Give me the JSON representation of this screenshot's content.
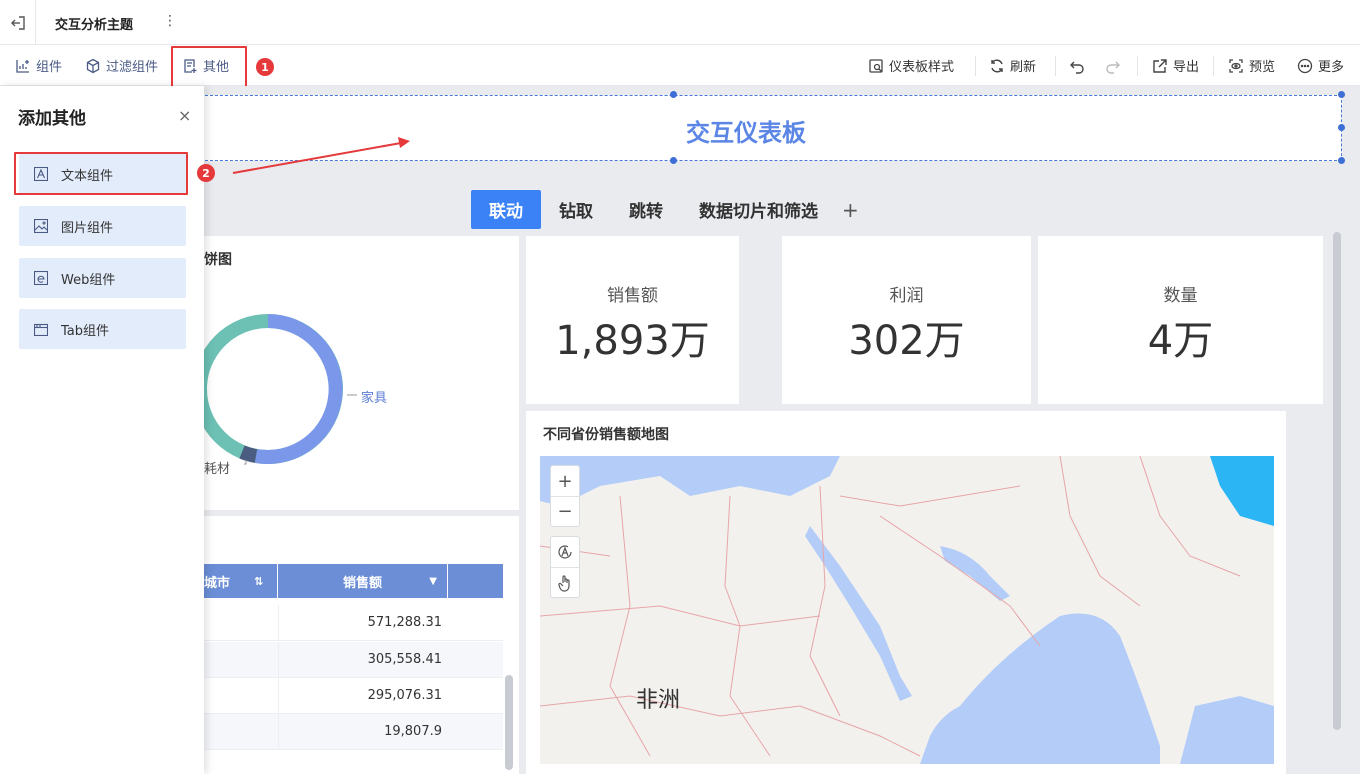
{
  "topbar": {
    "title": "交互分析主题",
    "more_icon": "kebab-icon"
  },
  "toolbar": {
    "left": [
      {
        "label": "组件",
        "icon": "chart-add-icon"
      },
      {
        "label": "过滤组件",
        "icon": "filter-cube-icon"
      },
      {
        "label": "其他",
        "icon": "doc-add-icon"
      }
    ],
    "right": [
      {
        "label": "仪表板样式",
        "icon": "style-icon"
      },
      {
        "label": "刷新",
        "icon": "refresh-icon"
      },
      {
        "label": "导出",
        "icon": "export-icon"
      },
      {
        "label": "预览",
        "icon": "preview-icon"
      },
      {
        "label": "更多",
        "icon": "more-icon"
      }
    ]
  },
  "annotations": {
    "step1": "1",
    "step2": "2"
  },
  "dashboard": {
    "title": "交互仪表板",
    "tabs": [
      "联动",
      "钻取",
      "跳转",
      "数据切片和筛选"
    ],
    "tab_add": "+",
    "pie": {
      "title_fragment": "饼图",
      "label_furniture": "家具",
      "label_consumables": "耗材",
      "colors": {
        "furniture": "#7b97ea",
        "teal": "#6cc0b4",
        "dark": "#4a5d80"
      }
    },
    "kpis": [
      {
        "label": "销售额",
        "value": "1,893万"
      },
      {
        "label": "利润",
        "value": "302万"
      },
      {
        "label": "数量",
        "value": "4万"
      }
    ],
    "table": {
      "col_city": "城市",
      "col_sales": "销售额",
      "rows": [
        "571,288.31",
        "305,558.41",
        "295,076.31",
        "19,807.9"
      ]
    },
    "map": {
      "title": "不同省份销售额地图",
      "zoom_in": "+",
      "zoom_out": "−",
      "region_label": "非洲"
    }
  },
  "panel": {
    "title": "添加其他",
    "close": "×",
    "items": [
      {
        "label": "文本组件",
        "icon": "text-widget-icon"
      },
      {
        "label": "图片组件",
        "icon": "image-widget-icon"
      },
      {
        "label": "Web组件",
        "icon": "web-widget-icon"
      },
      {
        "label": "Tab组件",
        "icon": "tab-widget-icon"
      }
    ]
  }
}
